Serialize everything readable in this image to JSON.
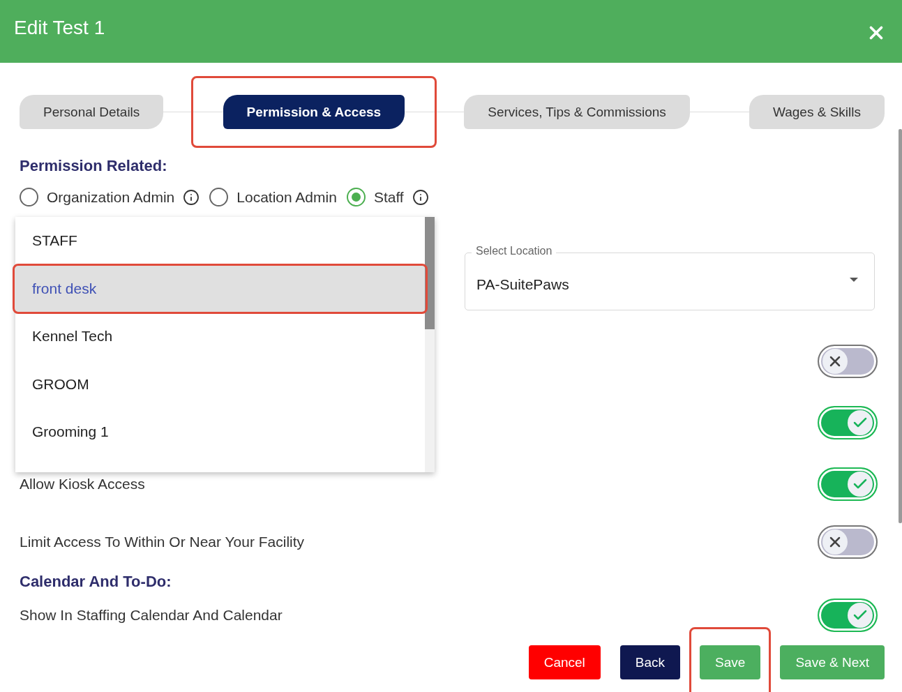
{
  "window": {
    "title": "Edit Test 1"
  },
  "tabs": [
    {
      "label": "Personal Details",
      "selected": false,
      "highlighted": false
    },
    {
      "label": "Permission & Access",
      "selected": true,
      "highlighted": true
    },
    {
      "label": "Services, Tips & Commissions",
      "selected": false,
      "highlighted": false
    },
    {
      "label": "Wages & Skills",
      "selected": false,
      "highlighted": false
    }
  ],
  "permission_section": {
    "heading": "Permission Related:",
    "roles": [
      {
        "label": "Organization Admin",
        "selected": false,
        "info": true
      },
      {
        "label": "Location Admin",
        "selected": false,
        "info": false
      },
      {
        "label": "Staff",
        "selected": true,
        "info": true
      }
    ]
  },
  "role_menu": {
    "options": [
      {
        "label": "STAFF",
        "selected": false,
        "highlighted": false
      },
      {
        "label": "front desk",
        "selected": true,
        "highlighted": true
      },
      {
        "label": "Kennel Tech",
        "selected": false,
        "highlighted": false
      },
      {
        "label": "GROOM",
        "selected": false,
        "highlighted": false
      },
      {
        "label": "Grooming 1",
        "selected": false,
        "highlighted": false
      }
    ]
  },
  "location_field": {
    "label": "Select Location",
    "value": "PA-SuitePaws"
  },
  "toggles": [
    {
      "on": false
    },
    {
      "on": true
    },
    {
      "label": "Allow Kiosk Access",
      "on": true
    },
    {
      "label": "Limit Access To Within Or Near Your Facility",
      "on": false
    }
  ],
  "calendar_section": {
    "heading": "Calendar And To-Do:",
    "toggles": [
      {
        "label": "Show In Staffing Calendar And Calendar",
        "on": true
      }
    ]
  },
  "buttons": [
    {
      "label": "Cancel",
      "kind": "cancel",
      "highlighted": false
    },
    {
      "label": "Back",
      "kind": "back",
      "highlighted": false
    },
    {
      "label": "Save",
      "kind": "save",
      "highlighted": true
    },
    {
      "label": "Save & Next",
      "kind": "next",
      "highlighted": false
    }
  ]
}
